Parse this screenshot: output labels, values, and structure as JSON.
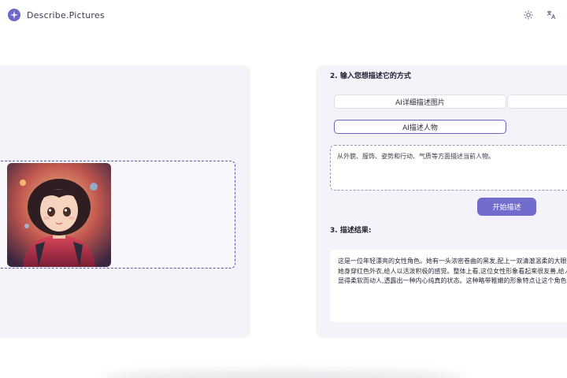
{
  "header": {
    "brand": "Describe.Pictures",
    "icons": [
      "sparkle-logo-icon",
      "sun-icon",
      "translate-icon"
    ]
  },
  "panel": {
    "section2_title": "2. 输入您想描述它的方式",
    "options": [
      {
        "label": "AI详细描述图片",
        "active": false
      },
      {
        "label": "",
        "active": false
      },
      {
        "label": "AI描述人物",
        "active": true
      }
    ],
    "input_text": "从外貌、服饰、姿势和行动、气质等方面描述当前人物。",
    "start_label": "开始描述",
    "section3_title": "3. 描述结果:",
    "result_lines": [
      "这是一位年轻漂亮的女性角色。她有一头浓密卷曲的黑发,配上一双清澈温柔的大眼",
      "她身穿红色外衣,给人以活泼积极的感觉。整体上看,这位女性形象看起来很友善,给人",
      "显得柔软而动人,透露出一种内心纯真的状态。这种略带稚嫩的形象特点让这个角色"
    ]
  },
  "colors": {
    "accent": "#726ccc",
    "panel_bg": "#f3f3f9"
  }
}
